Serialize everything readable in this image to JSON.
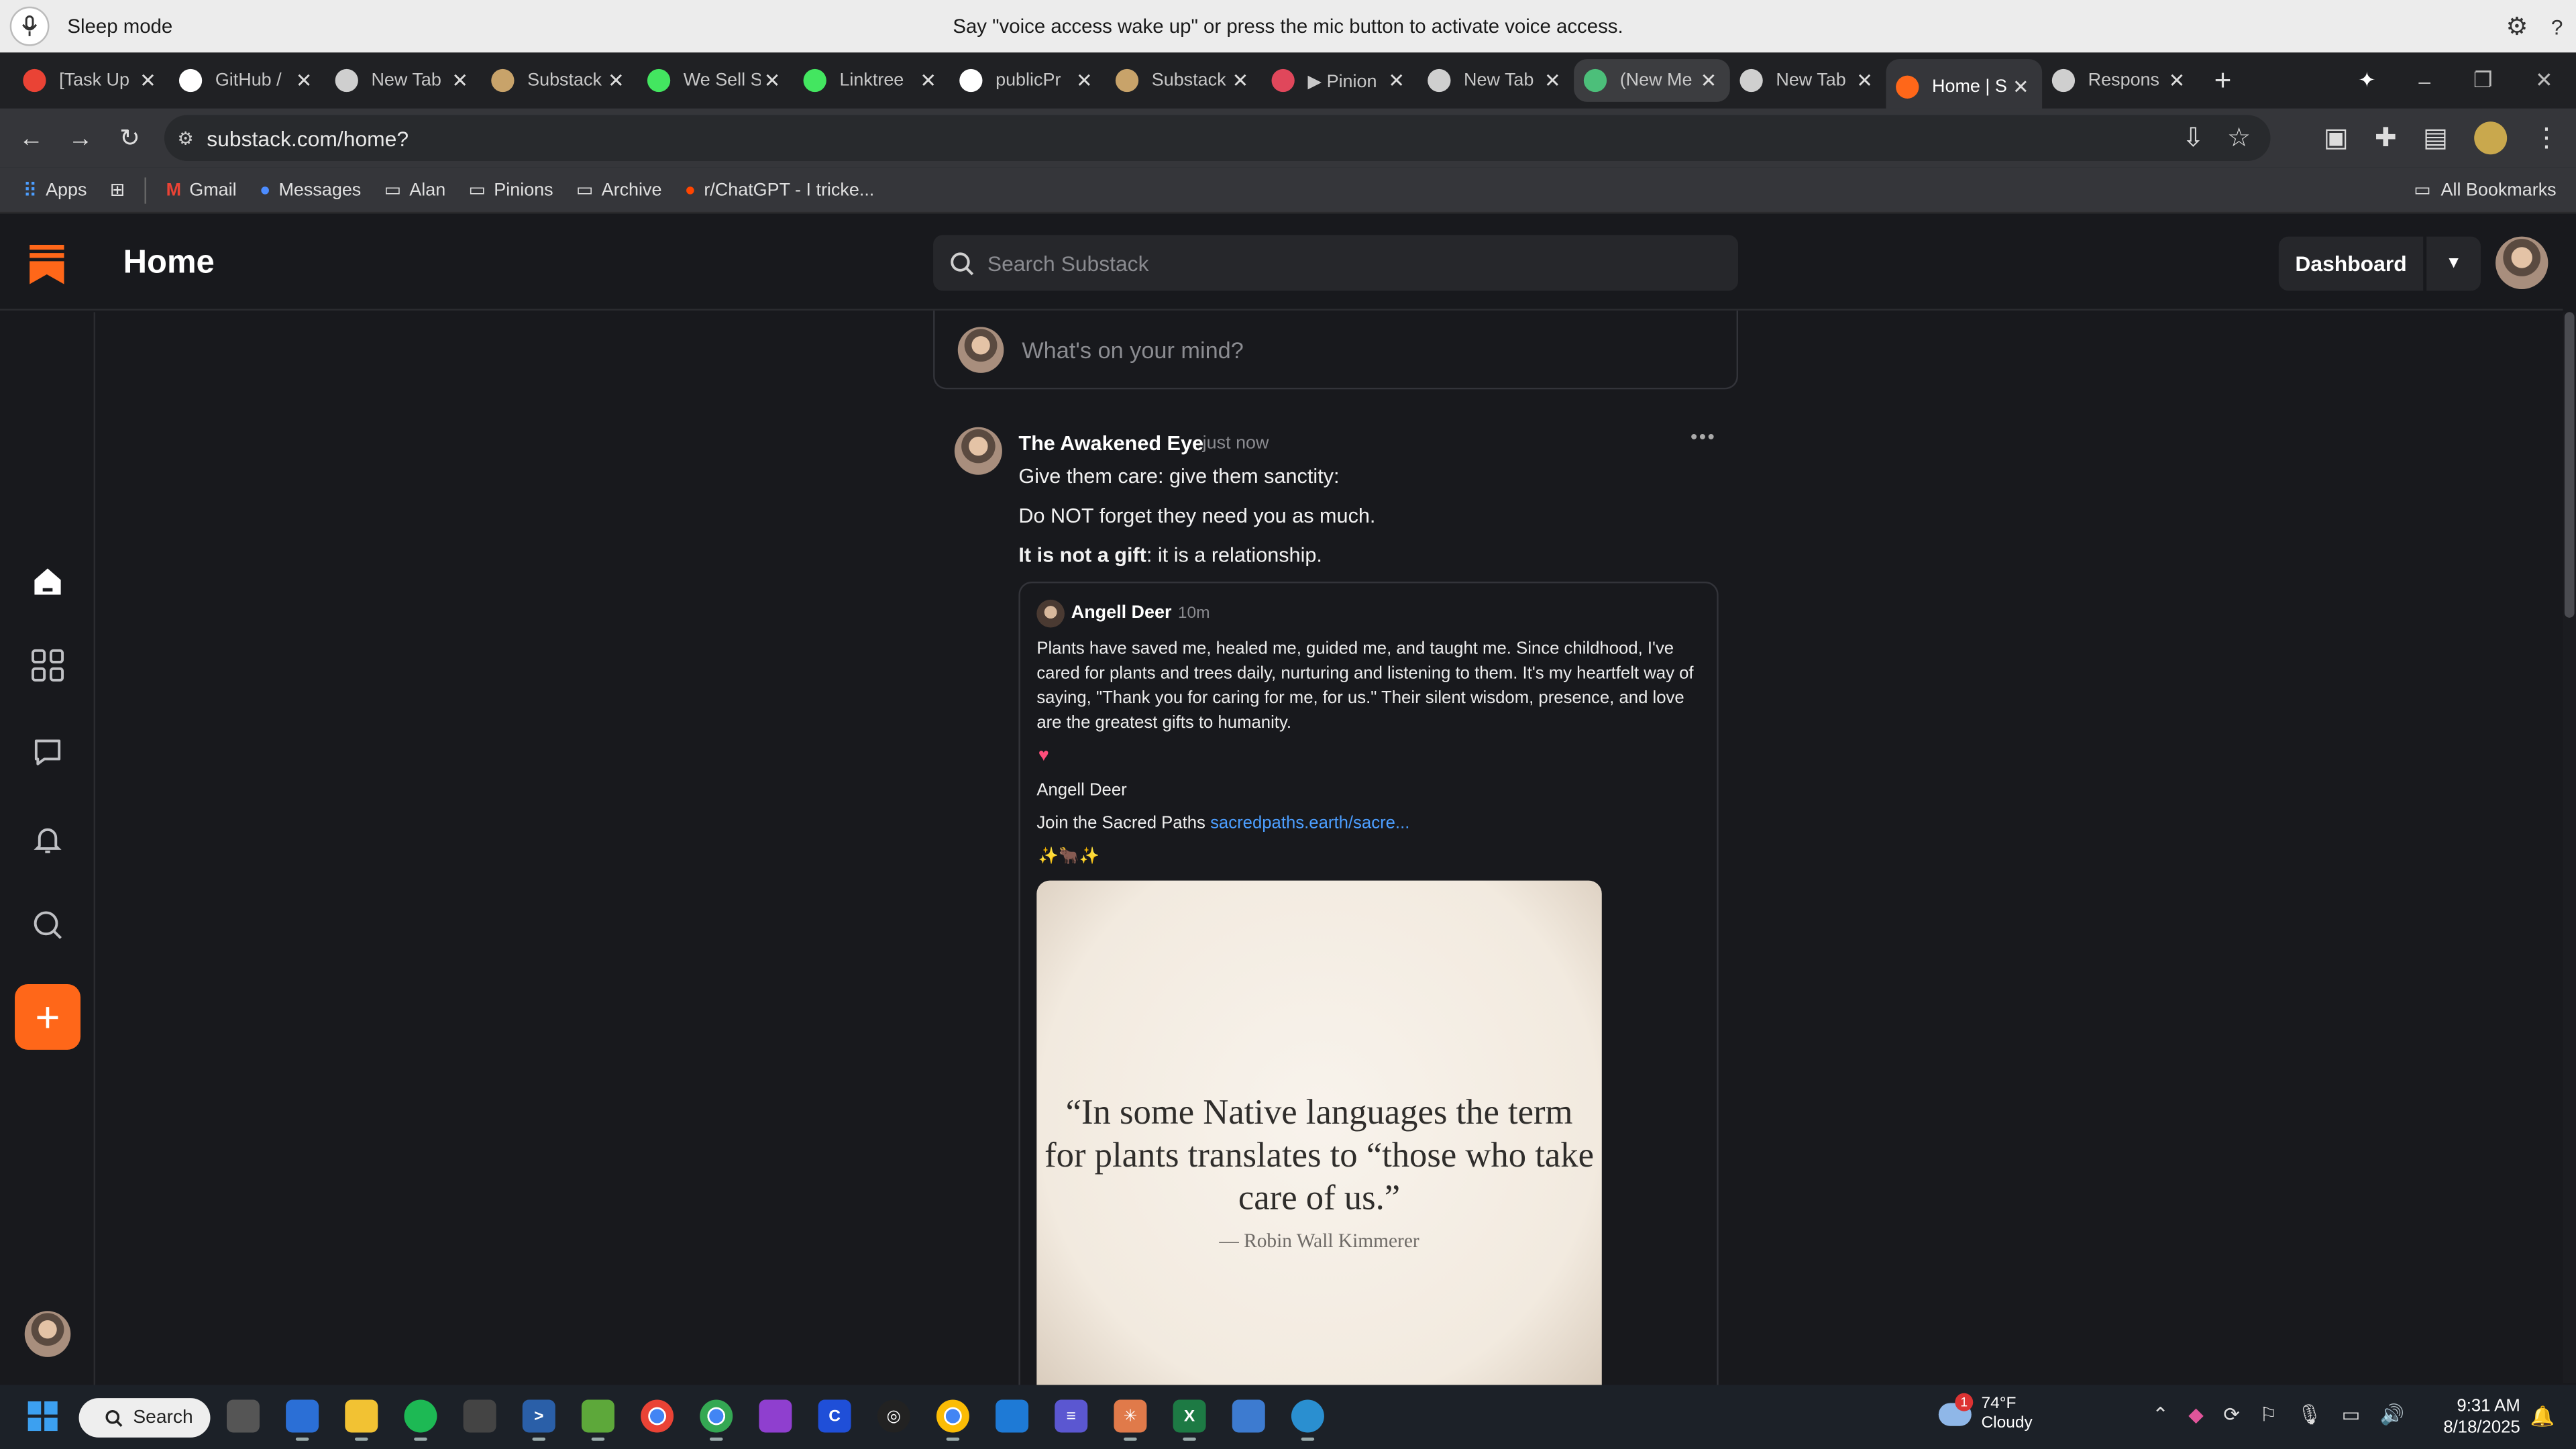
{
  "voice_access": {
    "mode": "Sleep mode",
    "message": "Say \"voice access wake up\" or press the mic button to activate voice access."
  },
  "tabs": [
    {
      "label": "[Task Up",
      "icon": "gmail-icon",
      "color": "#ea4335"
    },
    {
      "label": "GitHub /",
      "icon": "github-icon",
      "color": "#ffffff"
    },
    {
      "label": "New Tab",
      "icon": "chrome-icon",
      "color": "#cfcfcf"
    },
    {
      "label": "Substack",
      "icon": "substack-hat-icon",
      "color": "#c8a36a"
    },
    {
      "label": "We Sell S",
      "icon": "linktree-icon",
      "color": "#43e660"
    },
    {
      "label": "Linktree",
      "icon": "linktree-icon",
      "color": "#43e660"
    },
    {
      "label": "publicPr",
      "icon": "github-icon",
      "color": "#ffffff"
    },
    {
      "label": "Substack",
      "icon": "substack-hat-icon",
      "color": "#c8a36a"
    },
    {
      "label": "▶ Pinion",
      "icon": "pinion-icon",
      "color": "#e0475b"
    },
    {
      "label": "New Tab",
      "icon": "chrome-icon",
      "color": "#cfcfcf"
    },
    {
      "label": "(New Me",
      "icon": "shield-icon",
      "color": "#4cbf7a"
    },
    {
      "label": "New Tab",
      "icon": "chrome-icon",
      "color": "#cfcfcf"
    },
    {
      "label": "Home | S",
      "icon": "substack-icon",
      "color": "#ff6719"
    },
    {
      "label": "Respons",
      "icon": "openai-icon",
      "color": "#cfcfcf"
    }
  ],
  "active_tab": 12,
  "address": "substack.com/home?",
  "bookmarks": {
    "apps": "Apps",
    "items": [
      "Gmail",
      "Messages",
      "Alan",
      "Pinions",
      "Archive",
      "r/ChatGPT - I tricke..."
    ],
    "all": "All Bookmarks"
  },
  "substack": {
    "title": "Home",
    "search_placeholder": "Search Substack",
    "dashboard": "Dashboard",
    "composer_placeholder": "What's on your mind?",
    "accent": "#ff6719"
  },
  "post": {
    "author": "The Awakened Eye",
    "time": "just now",
    "line1": "Give them care: give them sanctity:",
    "line2": "Do NOT forget they need you as much.",
    "line3_bold": "It is not a gift",
    "line3_rest": ": it is a relationship.",
    "quoted": {
      "author": "Angell Deer",
      "time": "10m",
      "body": "Plants have saved me, healed me, guided me, and taught me. Since childhood, I've cared for plants and trees daily, nurturing and listening to them. It's my heartfelt way of saying, \"Thank you for caring for me, for us.\" Their silent wisdom, presence, and love are the greatest gifts to humanity.",
      "heart": "♥",
      "signature": "Angell Deer",
      "join_text": "Join the Sacred Paths ",
      "join_link": "sacredpaths.earth/sacre...",
      "emoji": "✨🐂✨",
      "image_quote": "“In some Native languages the term for plants translates to “those who take care of us.”",
      "image_attribution": "— Robin Wall Kimmerer"
    }
  },
  "taskbar": {
    "search": "Search",
    "weather_temp": "74°F",
    "weather_desc": "Cloudy",
    "weather_badge": "1",
    "time": "9:31 AM",
    "date": "8/18/2025"
  }
}
